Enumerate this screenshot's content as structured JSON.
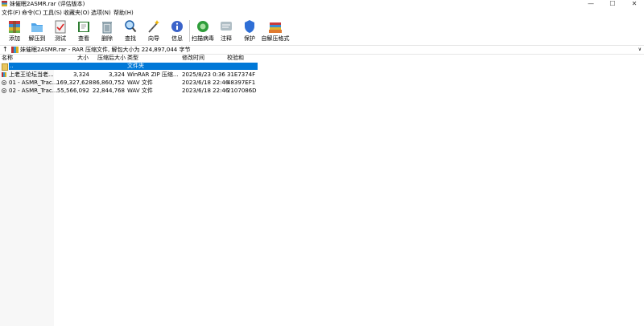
{
  "window": {
    "title": "妹催眠2ASMR.rar (评估版本)",
    "controls": {
      "minimize": "—",
      "maximize": "☐",
      "close": "✕"
    }
  },
  "menu": [
    "文件(F)",
    "命令(C)",
    "工具(S)",
    "收藏夹(O)",
    "选项(N)",
    "帮助(H)"
  ],
  "toolbar": [
    {
      "label": "添加",
      "icon": "add-archive-icon"
    },
    {
      "label": "解压到",
      "icon": "extract-to-folder-icon"
    },
    {
      "label": "测试",
      "icon": "test-clipboard-icon"
    },
    {
      "label": "查看",
      "icon": "view-book-icon"
    },
    {
      "label": "删除",
      "icon": "delete-trash-icon"
    },
    {
      "label": "查找",
      "icon": "find-magnifier-icon"
    },
    {
      "label": "向导",
      "icon": "wizard-wand-icon"
    },
    {
      "label": "信息",
      "icon": "info-icon"
    },
    {
      "label": "扫描病毒",
      "icon": "virus-scan-icon"
    },
    {
      "label": "注释",
      "icon": "comment-icon"
    },
    {
      "label": "保护",
      "icon": "protect-shield-icon"
    },
    {
      "label": "自解压格式",
      "icon": "sfx-icon"
    }
  ],
  "address": {
    "text": "妹催眠2ASMR.rar - RAR 压缩文件, 解包大小为 224,897,044 字节",
    "up": "↑",
    "dropdown": "∨"
  },
  "columns": [
    "名称",
    "大小",
    "压缩后大小",
    "类型",
    "修改时间",
    "校验和"
  ],
  "rows": [
    {
      "name": "..",
      "size": "",
      "packed": "",
      "type": "文件夹",
      "modified": "",
      "crc": "",
      "selected": true
    },
    {
      "name": "上老王论坛当老...",
      "size": "3,324",
      "packed": "3,324",
      "type": "WinRAR ZIP 压缩...",
      "modified": "2025/8/23 0:36",
      "crc": "31E7374F"
    },
    {
      "name": "01 - ASMR_Trac...",
      "size": "169,327,628",
      "packed": "86,860,752",
      "type": "WAV 文件",
      "modified": "2023/6/18 22:46",
      "crc": "48397EF1"
    },
    {
      "name": "02 - ASMR_Trac...",
      "size": "55,566,092",
      "packed": "22,844,768",
      "type": "WAV 文件",
      "modified": "2023/6/18 22:46",
      "crc": "2107086D"
    }
  ]
}
